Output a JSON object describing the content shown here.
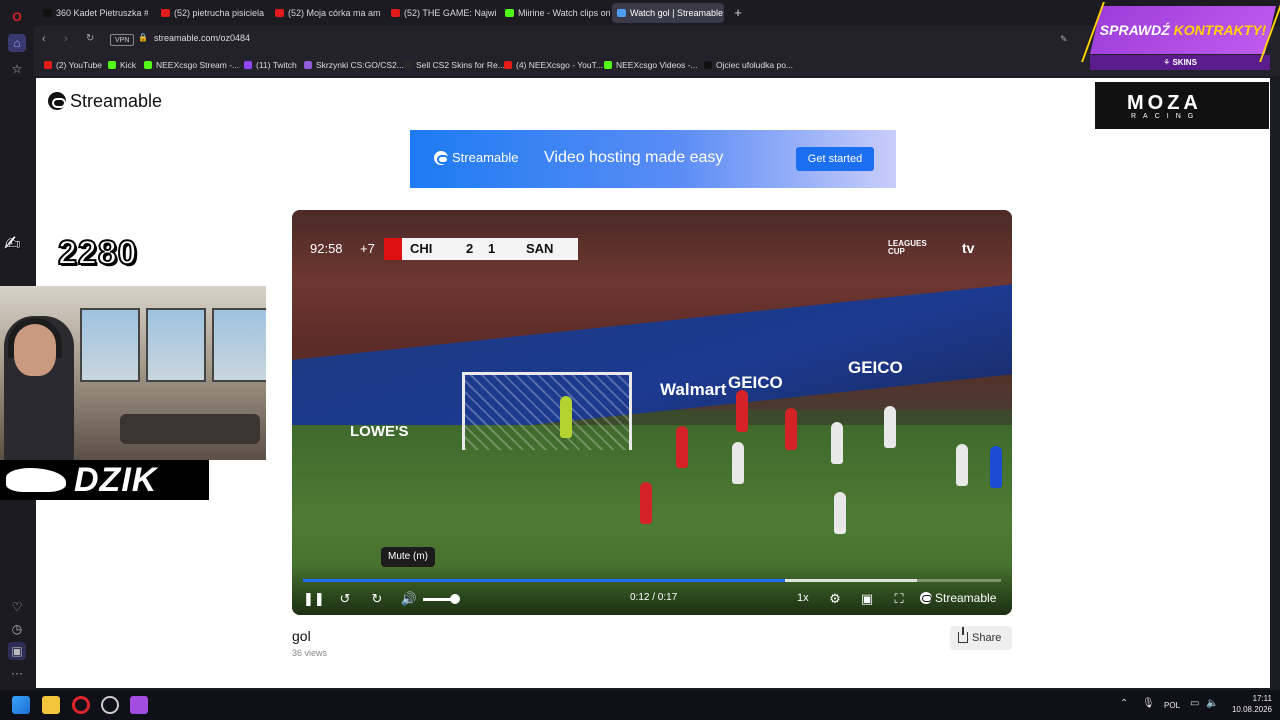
{
  "browser": {
    "tabs": [
      {
        "label": "360 Kadet Pietruszka #gta",
        "fav": "#111111"
      },
      {
        "label": "(52) pietrucha pisiciela có",
        "fav": "#e41b1b"
      },
      {
        "label": "(52) Moja córka ma aman",
        "fav": "#e41b1b"
      },
      {
        "label": "(52) THE GAME: Największ",
        "fav": "#e41b1b"
      },
      {
        "label": "Miirine - Watch clips on K",
        "fav": "#53fc18"
      },
      {
        "label": "Watch gol | Streamable",
        "fav": "#4d9ef7",
        "active": true
      }
    ],
    "vpn_label": "VPN",
    "url": "streamable.com/oz0484",
    "bookmarks": [
      {
        "label": "(2) YouTube",
        "fav": "#e41b1b"
      },
      {
        "label": "Kick",
        "fav": "#53fc18"
      },
      {
        "label": "NEEXcsgo Stream -...",
        "fav": "#53fc18"
      },
      {
        "label": "(11) Twitch",
        "fav": "#9146ff"
      },
      {
        "label": "Skrzynki CS:GO/CS2...",
        "fav": "#8e5cd8"
      },
      {
        "label": "Sell CS2 Skins for Re...",
        "fav": "#2a2a2a"
      },
      {
        "label": "(4) NEEXcsgo - YouT...",
        "fav": "#e41b1b"
      },
      {
        "label": "NEEXcsgo Videos -...",
        "fav": "#53fc18"
      },
      {
        "label": "Ojciec ufoludka po...",
        "fav": "#111111"
      }
    ]
  },
  "page": {
    "logo": "Streamable",
    "banner": {
      "logo": "Streamable",
      "tagline": "Video hosting made easy",
      "cta": "Get started"
    },
    "sponsor_ad": {
      "line1": "MOZA",
      "line2": "RACING"
    }
  },
  "video": {
    "scoreboard": {
      "clock": "92:58",
      "added": "+7",
      "home": "CHI",
      "home_score": "2",
      "away_score": "1",
      "away": "SAN"
    },
    "broadcaster": {
      "league": "LEAGUES CUP",
      "network": "tv"
    },
    "ads": [
      "Walmart",
      "GEICO",
      "GEICO",
      "LOWE'S"
    ],
    "tooltip": "Mute (m)",
    "time": "0:12 / 0:17",
    "progress_played": 0.69,
    "progress_buffered": 0.88,
    "volume": 1.0,
    "speed": "1x",
    "watermark": "Streamable",
    "title": "gol",
    "views": "36 views",
    "share_label": "Share"
  },
  "overlay": {
    "score_tag": "2280",
    "brand": "DZIK",
    "promo": {
      "text_a": "SPRAWDŹ",
      "text_b": "KONTRAKTY!",
      "sponsor": "SKINS"
    }
  },
  "taskbar": {
    "lang": "POL",
    "time": "17:11",
    "date": "10.08.2026"
  }
}
